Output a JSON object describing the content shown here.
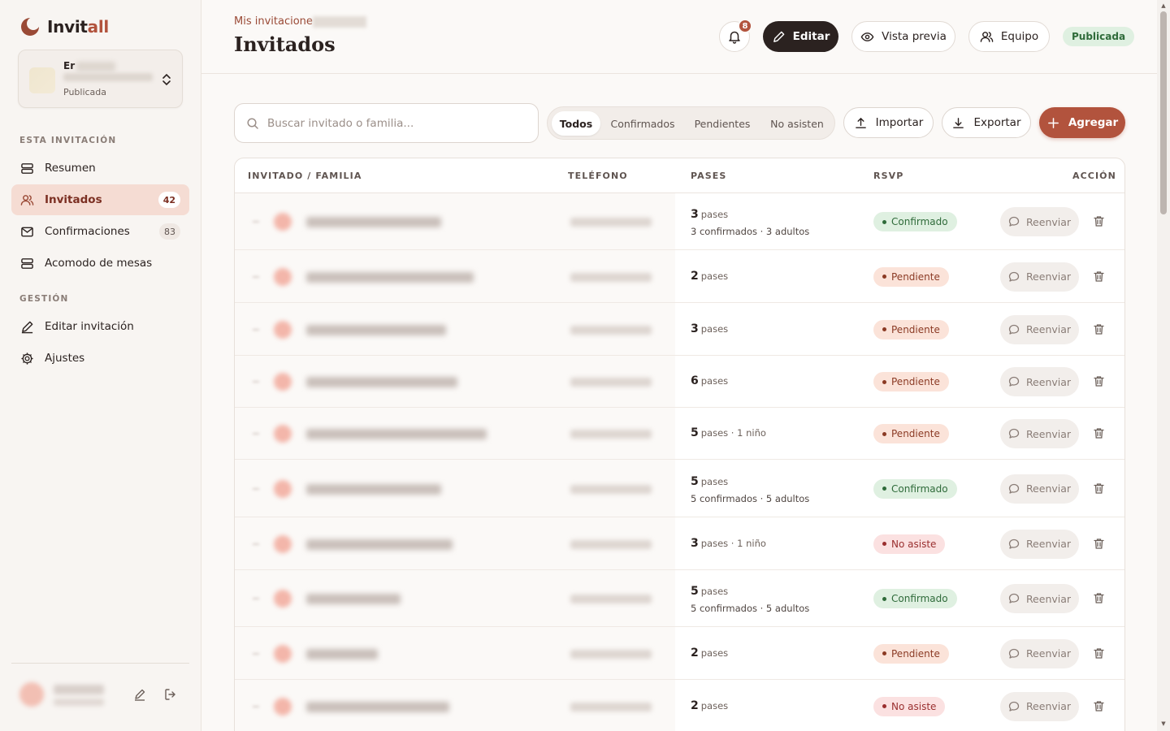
{
  "brand": {
    "name_main": "Invit",
    "name_accent": "all"
  },
  "event": {
    "name": "Er",
    "status": "Publicada"
  },
  "sidebar": {
    "section1": "ESTA INVITACIÓN",
    "section2": "GESTIÓN",
    "items": [
      {
        "label": "Resumen"
      },
      {
        "label": "Invitados",
        "count": "42"
      },
      {
        "label": "Confirmaciones",
        "count": "83"
      },
      {
        "label": "Acomodo de mesas"
      },
      {
        "label": "Editar invitación"
      },
      {
        "label": "Ajustes"
      }
    ]
  },
  "header": {
    "breadcrumb": "Mis invitacione",
    "title": "Invitados",
    "notifications": "8",
    "edit_label": "Editar",
    "preview_label": "Vista previa",
    "team_label": "Equipo",
    "status_badge": "Publicada"
  },
  "toolbar": {
    "search_placeholder": "Buscar invitado o familia...",
    "filters": [
      "Todos",
      "Confirmados",
      "Pendientes",
      "No asisten"
    ],
    "import_label": "Importar",
    "export_label": "Exportar",
    "add_label": "Agregar"
  },
  "table": {
    "columns": [
      "INVITADO / FAMILIA",
      "TELÉFONO",
      "PASES",
      "RSVP",
      "ACCIÓN"
    ],
    "passes_word": "pases",
    "resend_label": "Reenviar",
    "rows": [
      {
        "passes": "3",
        "extra": "",
        "sub": "3 confirmados · 3 adultos",
        "rsvp": "Confirmado",
        "status": "confirmado"
      },
      {
        "passes": "2",
        "extra": "",
        "sub": "",
        "rsvp": "Pendiente",
        "status": "pendiente"
      },
      {
        "passes": "3",
        "extra": "",
        "sub": "",
        "rsvp": "Pendiente",
        "status": "pendiente"
      },
      {
        "passes": "6",
        "extra": "",
        "sub": "",
        "rsvp": "Pendiente",
        "status": "pendiente"
      },
      {
        "passes": "5",
        "extra": " · 1 niño",
        "sub": "",
        "rsvp": "Pendiente",
        "status": "pendiente"
      },
      {
        "passes": "5",
        "extra": "",
        "sub": "5 confirmados · 5 adultos",
        "rsvp": "Confirmado",
        "status": "confirmado"
      },
      {
        "passes": "3",
        "extra": " · 1 niño",
        "sub": "",
        "rsvp": "No asiste",
        "status": "noasiste"
      },
      {
        "passes": "5",
        "extra": "",
        "sub": "5 confirmados · 5 adultos",
        "rsvp": "Confirmado",
        "status": "confirmado"
      },
      {
        "passes": "2",
        "extra": "",
        "sub": "",
        "rsvp": "Pendiente",
        "status": "pendiente"
      },
      {
        "passes": "2",
        "extra": "",
        "sub": "",
        "rsvp": "No asiste",
        "status": "noasiste"
      }
    ]
  },
  "colors": {
    "accent": "#b2533d",
    "dark": "#2b2220",
    "confirmed": "#2f6b3a",
    "pending": "#8b3a24"
  }
}
